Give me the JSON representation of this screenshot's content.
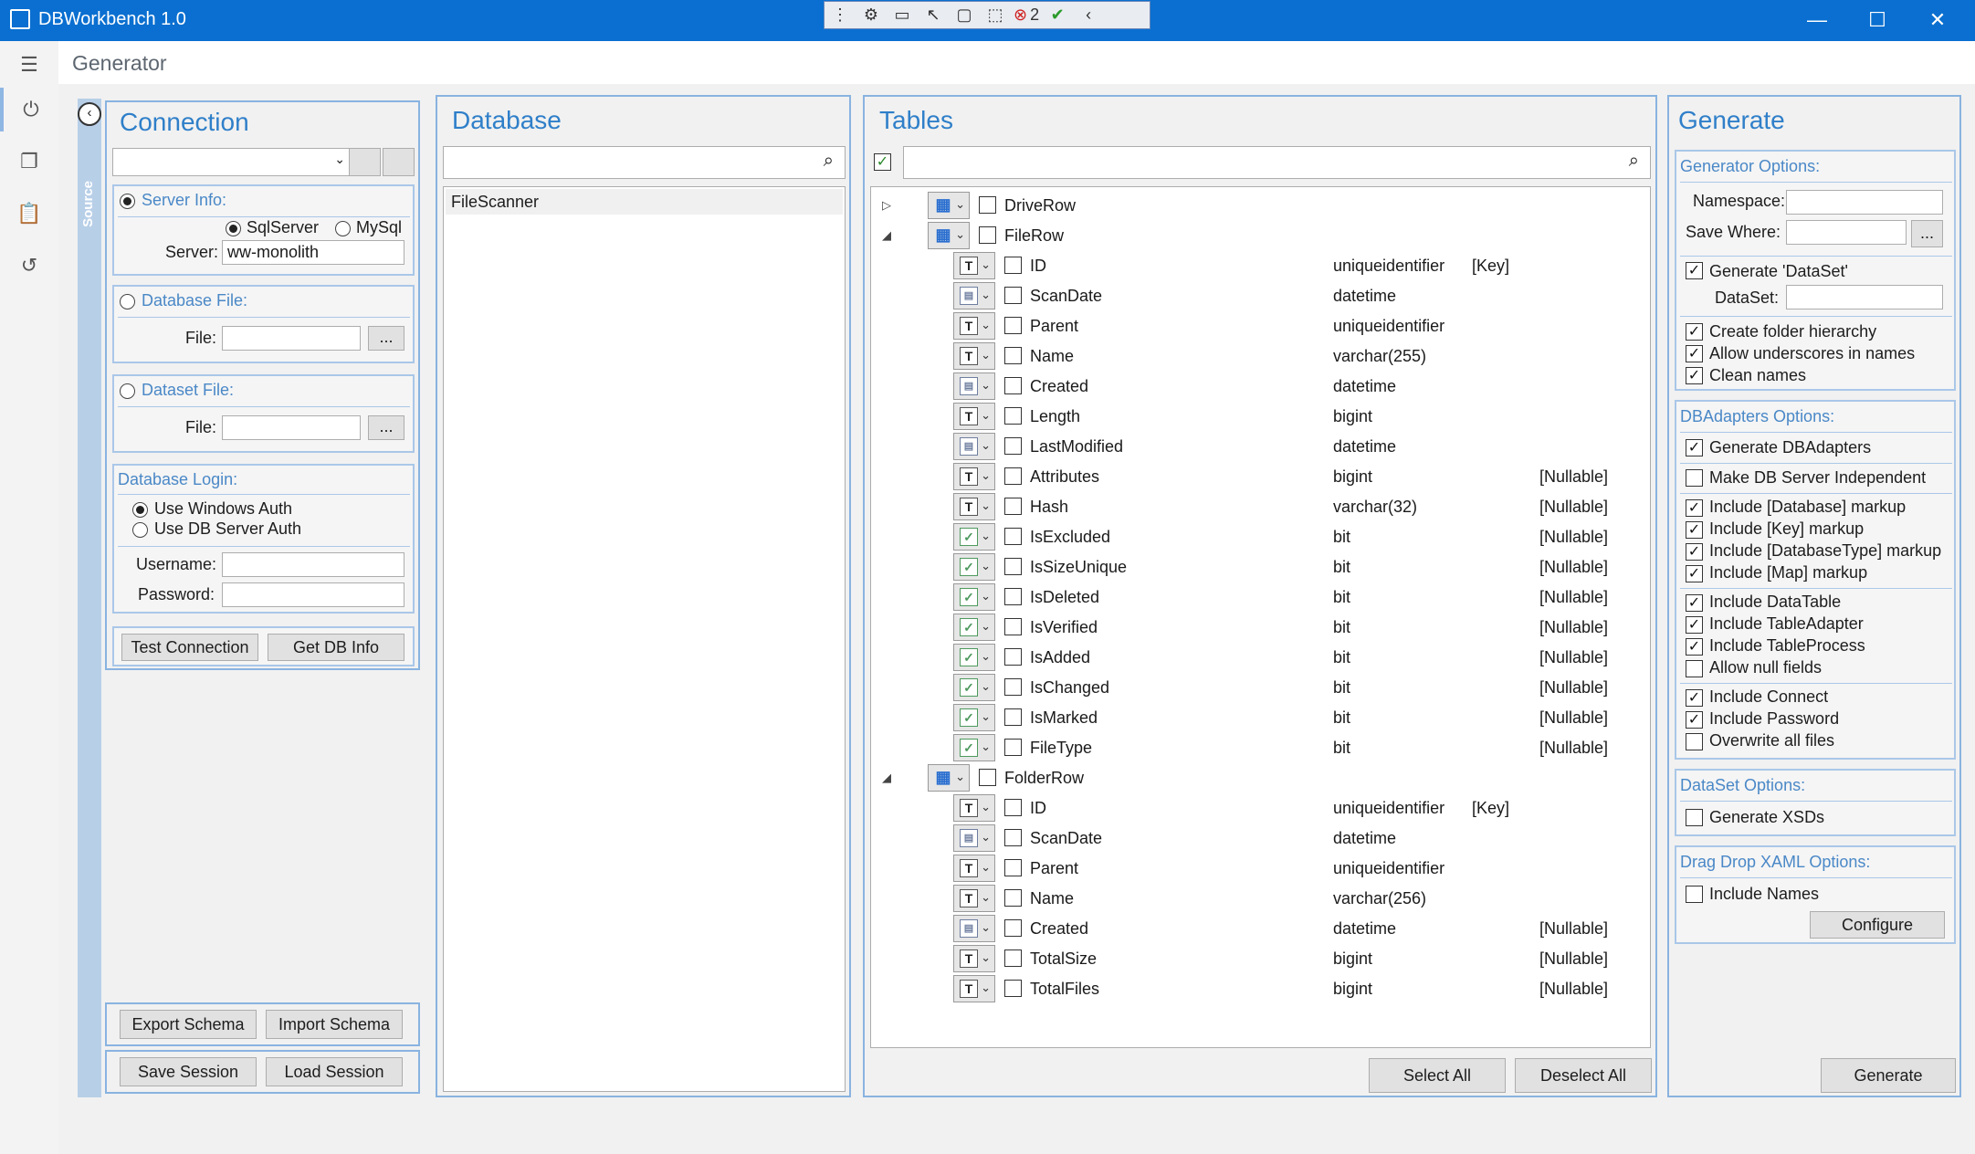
{
  "window": {
    "title": "DBWorkbench 1.0",
    "minimize": "—",
    "maximize": "☐",
    "close": "✕"
  },
  "debug_toolbar": {
    "error_count": "2"
  },
  "page": {
    "title": "Generator"
  },
  "connection": {
    "title": "Connection",
    "source_tab": "Source",
    "server_info_label": "Server Info:",
    "sqlserver_label": "SqlServer",
    "mysql_label": "MySql",
    "server_label": "Server:",
    "server_value": "ww-monolith",
    "database_file_label": "Database File:",
    "file_label": "File:",
    "dataset_file_label": "Dataset File:",
    "browse_label": "...",
    "login_label": "Database Login:",
    "windows_auth": "Use Windows Auth",
    "db_auth": "Use DB Server Auth",
    "username_label": "Username:",
    "password_label": "Password:",
    "test_button": "Test Connection",
    "getdb_button": "Get DB Info",
    "export_button": "Export Schema",
    "import_button": "Import Schema",
    "save_button": "Save Session",
    "load_button": "Load Session"
  },
  "database": {
    "title": "Database",
    "items": [
      "FileScanner"
    ]
  },
  "tables": {
    "title": "Tables",
    "select_all": "Select All",
    "deselect_all": "Deselect All",
    "rows": [
      {
        "kind": "table",
        "name": "DriveRow",
        "expanded": false
      },
      {
        "kind": "table",
        "name": "FileRow",
        "expanded": true
      },
      {
        "kind": "col",
        "icon": "T",
        "name": "ID",
        "type": "uniqueidentifier",
        "flag": "[Key]"
      },
      {
        "kind": "col",
        "icon": "date",
        "name": "ScanDate",
        "type": "datetime",
        "flag": ""
      },
      {
        "kind": "col",
        "icon": "T",
        "name": "Parent",
        "type": "uniqueidentifier",
        "flag": ""
      },
      {
        "kind": "col",
        "icon": "T",
        "name": "Name",
        "type": "varchar(255)",
        "flag": ""
      },
      {
        "kind": "col",
        "icon": "date",
        "name": "Created",
        "type": "datetime",
        "flag": ""
      },
      {
        "kind": "col",
        "icon": "T",
        "name": "Length",
        "type": "bigint",
        "flag": ""
      },
      {
        "kind": "col",
        "icon": "date",
        "name": "LastModified",
        "type": "datetime",
        "flag": ""
      },
      {
        "kind": "col",
        "icon": "T",
        "name": "Attributes",
        "type": "bigint",
        "flag": "[Nullable]"
      },
      {
        "kind": "col",
        "icon": "T",
        "name": "Hash",
        "type": "varchar(32)",
        "flag": "[Nullable]"
      },
      {
        "kind": "col",
        "icon": "bit",
        "name": "IsExcluded",
        "type": "bit",
        "flag": "[Nullable]"
      },
      {
        "kind": "col",
        "icon": "bit",
        "name": "IsSizeUnique",
        "type": "bit",
        "flag": "[Nullable]"
      },
      {
        "kind": "col",
        "icon": "bit",
        "name": "IsDeleted",
        "type": "bit",
        "flag": "[Nullable]"
      },
      {
        "kind": "col",
        "icon": "bit",
        "name": "IsVerified",
        "type": "bit",
        "flag": "[Nullable]"
      },
      {
        "kind": "col",
        "icon": "bit",
        "name": "IsAdded",
        "type": "bit",
        "flag": "[Nullable]"
      },
      {
        "kind": "col",
        "icon": "bit",
        "name": "IsChanged",
        "type": "bit",
        "flag": "[Nullable]"
      },
      {
        "kind": "col",
        "icon": "bit",
        "name": "IsMarked",
        "type": "bit",
        "flag": "[Nullable]"
      },
      {
        "kind": "col",
        "icon": "bit",
        "name": "FileType",
        "type": "bit",
        "flag": "[Nullable]"
      },
      {
        "kind": "table",
        "name": "FolderRow",
        "expanded": true
      },
      {
        "kind": "col",
        "icon": "T",
        "name": "ID",
        "type": "uniqueidentifier",
        "flag": "[Key]"
      },
      {
        "kind": "col",
        "icon": "date",
        "name": "ScanDate",
        "type": "datetime",
        "flag": ""
      },
      {
        "kind": "col",
        "icon": "T",
        "name": "Parent",
        "type": "uniqueidentifier",
        "flag": ""
      },
      {
        "kind": "col",
        "icon": "T",
        "name": "Name",
        "type": "varchar(256)",
        "flag": ""
      },
      {
        "kind": "col",
        "icon": "date",
        "name": "Created",
        "type": "datetime",
        "flag": "[Nullable]"
      },
      {
        "kind": "col",
        "icon": "T",
        "name": "TotalSize",
        "type": "bigint",
        "flag": "[Nullable]"
      },
      {
        "kind": "col",
        "icon": "T",
        "name": "TotalFiles",
        "type": "bigint",
        "flag": "[Nullable]"
      }
    ]
  },
  "generate": {
    "title": "Generate",
    "gen_options_label": "Generator Options:",
    "namespace_label": "Namespace:",
    "save_where_label": "Save Where:",
    "browse_label": "...",
    "generate_dataset": "Generate 'DataSet'",
    "dataset_label": "DataSet:",
    "create_folder": "Create folder hierarchy",
    "allow_underscores": "Allow underscores in names",
    "clean_names": "Clean names",
    "dbadapters_label": "DBAdapters Options:",
    "gen_dbadapters": "Generate DBAdapters",
    "make_independent": "Make DB Server Independent",
    "inc_database": "Include [Database] markup",
    "inc_key": "Include [Key] markup",
    "inc_dbtype": "Include [DatabaseType] markup",
    "inc_map": "Include [Map] markup",
    "inc_datatable": "Include DataTable",
    "inc_tableadapter": "Include TableAdapter",
    "inc_tableprocess": "Include TableProcess",
    "allow_null": "Allow null fields",
    "inc_connect": "Include Connect",
    "inc_password": "Include Password",
    "overwrite": "Overwrite all files",
    "dataset_options_label": "DataSet Options:",
    "gen_xsds": "Generate XSDs",
    "dragdrop_label": "Drag Drop XAML Options:",
    "include_names": "Include Names",
    "configure_button": "Configure",
    "generate_button": "Generate"
  },
  "icons": {
    "menu": "hamburger-icon",
    "power": "power-icon",
    "copy": "copy-icon",
    "clipboard": "clipboard-icon",
    "history": "history-icon",
    "search": "search-icon"
  },
  "colors": {
    "titlebar": "#0a6fd0",
    "accent": "#2f7fc9",
    "panel_border": "#89b3e0"
  }
}
